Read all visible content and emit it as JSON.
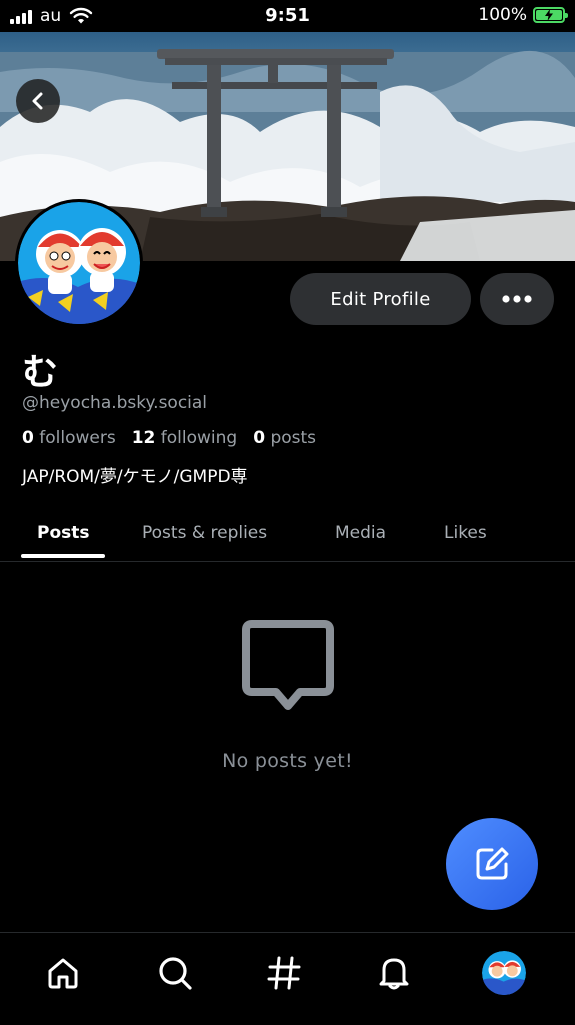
{
  "status_bar": {
    "carrier": "au",
    "time": "9:51",
    "battery_percent": "100%"
  },
  "profile": {
    "display_name": "む",
    "handle": "@heyocha.bsky.social",
    "followers_count": "0",
    "followers_label": "followers",
    "following_count": "12",
    "following_label": "following",
    "posts_count": "0",
    "posts_label": "posts",
    "bio": "JAP/ROM/夢/ケモノ/GMPD専"
  },
  "actions": {
    "edit_profile_label": "Edit Profile"
  },
  "tabs": [
    {
      "label": "Posts",
      "active": true
    },
    {
      "label": "Posts & replies",
      "active": false
    },
    {
      "label": "Media",
      "active": false
    },
    {
      "label": "Likes",
      "active": false
    }
  ],
  "empty_state": {
    "message": "No posts yet!"
  },
  "bottom_nav": [
    "home-icon",
    "search-icon",
    "feeds-hashtag-icon",
    "notifications-bell-icon",
    "profile-avatar"
  ],
  "colors": {
    "background": "#000000",
    "button_bg": "#2e3033",
    "fab": "#3b7af5",
    "muted_text": "#9aa0a6",
    "battery": "#4cd964"
  }
}
